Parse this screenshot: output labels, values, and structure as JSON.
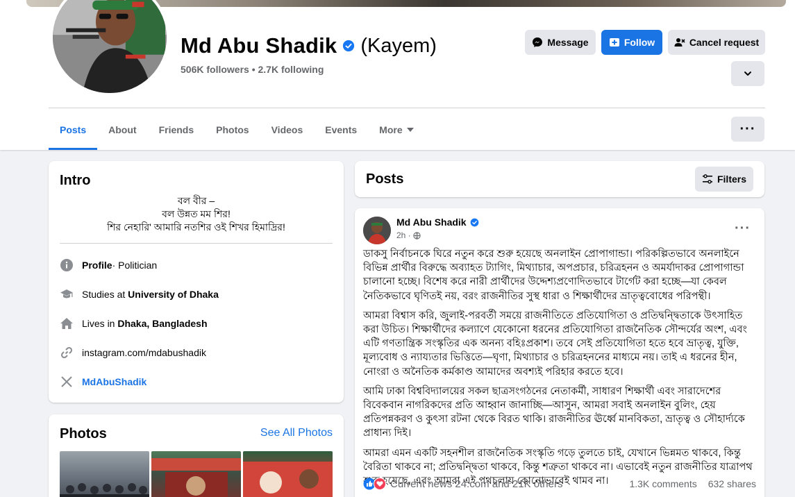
{
  "profile": {
    "name": "Md Abu Shadik",
    "alt_name": "(Kayem)",
    "stats": "506K followers • 2.7K following"
  },
  "actions": {
    "message": "Message",
    "follow": "Follow",
    "cancel_request": "Cancel request"
  },
  "tabs": {
    "posts": "Posts",
    "about": "About",
    "friends": "Friends",
    "photos": "Photos",
    "videos": "Videos",
    "events": "Events",
    "more": "More"
  },
  "intro": {
    "title": "Intro",
    "bio_line1": "বল বীর –",
    "bio_line2": "বল উন্নত মম শির!",
    "bio_line3": "শির নেহারি' আমারি নতশির ওই শিখর হিমাদ্রির!",
    "profile_label": "Profile",
    "profile_value": " · Politician",
    "studies_prefix": "Studies at ",
    "studies_value": "University of Dhaka",
    "lives_prefix": "Lives in ",
    "lives_value": "Dhaka, Bangladesh",
    "instagram": "instagram.com/mdabushadik",
    "x_handle": "MdAbuShadik"
  },
  "photos": {
    "title": "Photos",
    "see_all": "See All Photos"
  },
  "posts_header": {
    "title": "Posts",
    "filters": "Filters"
  },
  "post": {
    "author": "Md Abu Shadik",
    "time": "2h ·",
    "p1": "ডাকসু নির্বাচনকে ঘিরে নতুন করে শুরু হয়েছে অনলাইন প্রোপাগান্ডা। পরিকল্পিতভাবে অনলাইনে বিভিন্ন প্রার্থীর বিরুদ্ধে অব্যাহত ট্যাগিং, মিথ্যাচার, অপপ্রচার, চরিত্রহনন ও অমর্যাদাকর প্রোপাগান্ডা চালানো হচ্ছে। বিশেষ করে নারী প্রার্থীদের উদ্দেশ্যপ্রণোদিতভাবে টার্গেট করা হচ্ছে—যা কেবল নৈতিকভাবে ঘৃণিতই নয়, বরং রাজনীতির সুস্থ ধারা ও শিক্ষার্থীদের ভ্রাতৃত্ববোধের পরিপন্থী।",
    "p2": "আমরা বিশ্বাস করি, জুলাই-পরবর্তী সময়ে রাজনীতিতে প্রতিযোগিতা ও প্রতিদ্বন্দ্বিতাকে উৎসাহিত করা উচিত। শিক্ষার্থীদের কল্যাণে যেকোনো ধরনের প্রতিযোগিতা রাজনৈতিক সৌন্দর্যের অংশ, এবং এটি গণতান্ত্রিক সংস্কৃতির এক অনন্য বহিঃপ্রকাশ। তবে সেই প্রতিযোগিতা হতে হবে ভ্রাতৃত্ব, যুক্তি, মূল্যবোধ ও ন্যায্যতার ভিত্তিতে—ঘৃণা, মিথ্যাচার ও চরিত্রহননের মাধ্যমে নয়। তাই এ ধরনের হীন, নোংরা ও অনৈতিক কর্মকাণ্ড আমাদের অবশ্যই পরিহার করতে হবে।",
    "p3": "আমি ঢাকা বিশ্ববিদ্যালয়ের সকল ছাত্রসংগঠনের নেতাকর্মী, সাধারণ শিক্ষার্থী এবং সারাদেশের বিবেকবান নাগরিকদের প্রতি আহ্বান জানাচ্ছি—আসুন, আমরা সবাই অনলাইন বুলিং, হেয় প্রতিপন্নকরণ ও কুৎসা রটনা থেকে বিরত থাকি। রাজনীতির ঊর্ধ্বে মানবিকতা, ভ্রাতৃত্ব ও সৌহার্দ্যকে প্রাধান্য দিই।",
    "p4": "আমরা এমন একটি সহনশীল রাজনৈতিক সংস্কৃতি গড়ে তুলতে চাই, যেখানে ভিন্নমত থাকবে, কিন্তু বৈরিতা থাকবে না; প্রতিদ্বন্দ্বিতা থাকবে, কিন্তু শত্রুতা থাকবে না। এভাবেই নতুন রাজনীতির যাত্রাপথ শুরু হয়েছে, এবং আমরা এই পথচলায় কোনোভাবেই থামব না।",
    "reactions": "Current news 24.com and 21K others",
    "comments": "1.3K comments",
    "shares": "632 shares"
  },
  "colors": {
    "accent": "#1b74e4",
    "background": "#f0f2f5",
    "like_blue": "#1877f2",
    "love_red": "#f33e58"
  },
  "icons": [
    "verified-badge-icon",
    "messenger-icon",
    "follow-icon",
    "cancel-request-icon",
    "chevron-down-icon",
    "more-dots-icon",
    "info-icon",
    "graduation-cap-icon",
    "home-icon",
    "link-icon",
    "x-logo-icon",
    "filters-icon",
    "globe-icon",
    "like-icon",
    "love-icon"
  ]
}
